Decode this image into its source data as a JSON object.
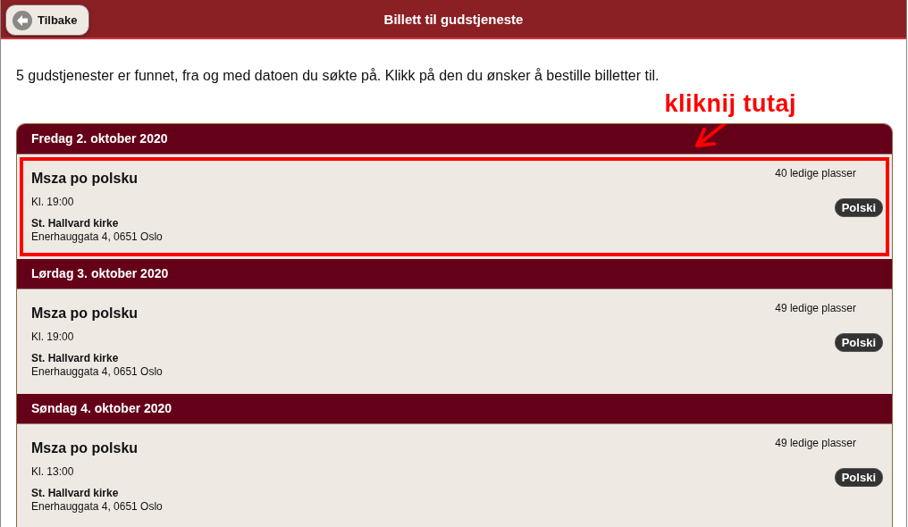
{
  "header": {
    "back_button": "Tilbake",
    "title": "Billett til gudstjeneste"
  },
  "intro": "5 gudstjenester er funnet, fra og med datoen du søkte på. Klikk på den du ønsker å bestille billetter til.",
  "annotation": {
    "text": "kliknij tutaj"
  },
  "days": [
    {
      "date": "Fredag 2. oktober 2020",
      "events": [
        {
          "name": "Msza po polsku",
          "time": "Kl. 19:00",
          "church": "St. Hallvard kirke",
          "address": "Enerhauggata 4, 0651 Oslo",
          "seats": "40 ledige plasser",
          "language": "Polski",
          "highlighted": true
        }
      ]
    },
    {
      "date": "Lørdag 3. oktober 2020",
      "events": [
        {
          "name": "Msza po polsku",
          "time": "Kl. 19:00",
          "church": "St. Hallvard kirke",
          "address": "Enerhauggata 4, 0651 Oslo",
          "seats": "49 ledige plasser",
          "language": "Polski",
          "highlighted": false
        }
      ]
    },
    {
      "date": "Søndag 4. oktober 2020",
      "events": [
        {
          "name": "Msza po polsku",
          "time": "Kl. 13:00",
          "church": "St. Hallvard kirke",
          "address": "Enerhauggata 4, 0651 Oslo",
          "seats": "49 ledige plasser",
          "language": "Polski",
          "highlighted": false
        }
      ]
    }
  ]
}
